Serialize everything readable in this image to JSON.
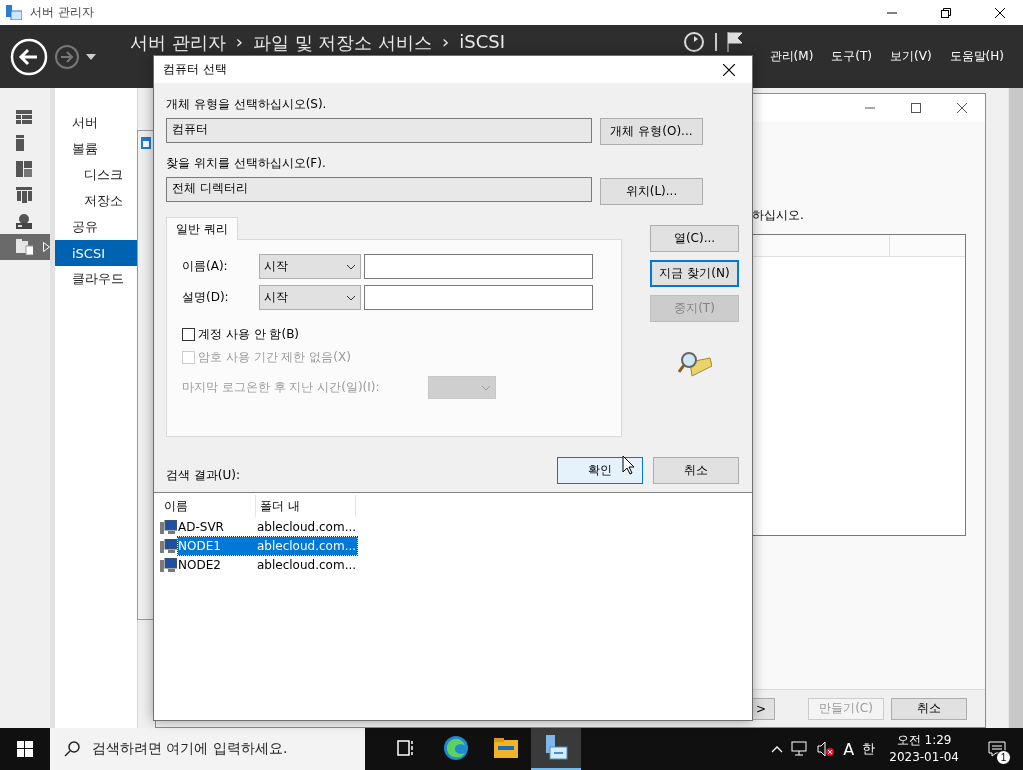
{
  "window": {
    "title": "서버 관리자"
  },
  "header": {
    "breadcrumb": [
      "서버 관리자",
      "›",
      "파일 및 저장소 서비스",
      "›",
      "iSCSI"
    ],
    "menus": [
      "관리(M)",
      "도구(T)",
      "보기(V)",
      "도움말(H)"
    ]
  },
  "rail": [
    {
      "kind": "dashboard",
      "selected": false
    },
    {
      "kind": "local-server",
      "selected": false
    },
    {
      "kind": "all-servers",
      "selected": false
    },
    {
      "kind": "server-group",
      "selected": false
    },
    {
      "kind": "storage-server",
      "selected": false
    },
    {
      "kind": "file-services",
      "selected": true
    }
  ],
  "nav": [
    {
      "label": "서버",
      "selected": false
    },
    {
      "label": "볼륨",
      "selected": false,
      "children": [
        {
          "label": "디스크",
          "selected": false
        },
        {
          "label": "저장소",
          "selected": false
        }
      ]
    },
    {
      "label": "공유",
      "selected": false
    },
    {
      "label": "iSCSI",
      "selected": true
    },
    {
      "label": "클라우드",
      "selected": false
    }
  ],
  "wizard": {
    "instruction": "하십시오.",
    "buttons": [
      {
        "label": ">",
        "disabled": false
      },
      {
        "label": "만들기(C)",
        "disabled": true
      },
      {
        "label": "취소",
        "disabled": false
      }
    ]
  },
  "dialog": {
    "title": "컴퓨터 선택",
    "object_type": {
      "label": "개체 유형을 선택하십시오(S).",
      "value": "컴퓨터",
      "button": "개체 유형(O)..."
    },
    "location": {
      "label": "찾을 위치를 선택하십시오(F).",
      "value": "전체 디렉터리",
      "button": "위치(L)..."
    },
    "tabs": [
      {
        "label": "일반 쿼리",
        "selected": true
      }
    ],
    "query_rows": [
      {
        "label": "이름(A):",
        "mode": "시작"
      },
      {
        "label": "설명(D):",
        "mode": "시작"
      }
    ],
    "checkboxes": [
      {
        "label": "계정 사용 안 함(B)",
        "checked": false,
        "disabled": false
      },
      {
        "label": "암호 사용 기간 제한 없음(X)",
        "checked": false,
        "disabled": true
      }
    ],
    "last_logon": {
      "label": "마지막 로그온한 후 지난 시간(일)(I):",
      "disabled": true
    },
    "side_buttons": [
      {
        "label": "열(C)...",
        "focused": false,
        "disabled": false
      },
      {
        "label": "지금 찾기(N)",
        "focused": true,
        "disabled": false
      },
      {
        "label": "중지(T)",
        "focused": false,
        "disabled": true
      }
    ],
    "actions": [
      {
        "label": "확인",
        "hovered": true
      },
      {
        "label": "취소",
        "hovered": false
      }
    ],
    "results": {
      "label": "검색 결과(U):",
      "columns": [
        "이름",
        "폴더 내"
      ],
      "rows": [
        {
          "name": "AD-SVR",
          "folder": "ablecloud.com...",
          "selected": false
        },
        {
          "name": "NODE1",
          "folder": "ablecloud.com...",
          "selected": true
        },
        {
          "name": "NODE2",
          "folder": "ablecloud.com...",
          "selected": false
        }
      ]
    }
  },
  "taskbar": {
    "search": {
      "placeholder": "검색하려면 여기에 입력하세요."
    },
    "apps": [
      {
        "kind": "task-view",
        "active": false
      },
      {
        "kind": "edge",
        "active": false
      },
      {
        "kind": "explorer",
        "active": false
      },
      {
        "kind": "server-manager",
        "active": true
      }
    ],
    "ime": [
      "A",
      "한"
    ],
    "time": "오전 1:29",
    "date": "2023-01-04",
    "notifications": "1"
  }
}
